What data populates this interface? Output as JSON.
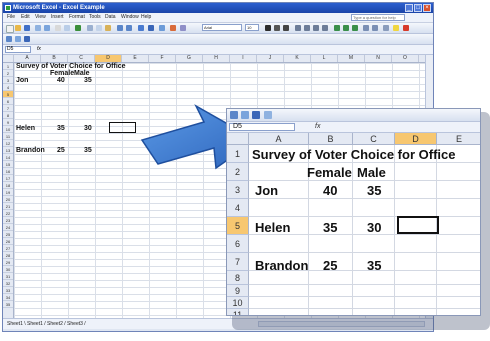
{
  "window": {
    "title": "Microsoft Excel - Excel Example",
    "menus": [
      "File",
      "Edit",
      "View",
      "Insert",
      "Format",
      "Tools",
      "Data",
      "Window",
      "Help"
    ],
    "ask_placeholder": "Type a question for help",
    "font_name": "Arial",
    "font_size": "10"
  },
  "main_sheet": {
    "name_box": "D5",
    "fx_label": "fx",
    "columns": [
      "A",
      "B",
      "C",
      "D",
      "E",
      "F",
      "G",
      "H",
      "I",
      "J",
      "K",
      "L",
      "M",
      "N",
      "O"
    ],
    "selected_column": "D",
    "rows": [
      "1",
      "2",
      "3",
      "4",
      "5",
      "6",
      "7",
      "8",
      "9",
      "10",
      "11",
      "12",
      "13",
      "14",
      "15",
      "16",
      "17",
      "18",
      "19",
      "20",
      "21",
      "22",
      "23",
      "24",
      "25",
      "26",
      "27",
      "28",
      "29",
      "30",
      "31",
      "32",
      "33",
      "34",
      "35"
    ],
    "selected_row": "5",
    "cells": {
      "a1": "Survey of Voter Choice for Office",
      "b2": "Female",
      "c2": "Male",
      "a3": "Jon",
      "b3": "40",
      "c3": "35",
      "a5": "Helen",
      "b5": "35",
      "c5": "30",
      "a7": "Brandon",
      "b7": "25",
      "c7": "35"
    },
    "tabs_text": "Sheet1 \\ Sheet1 / Sheet2 / Sheet3 /"
  },
  "zoom_sheet": {
    "name_box": "D5",
    "fx_label": "fx",
    "columns": [
      "A",
      "B",
      "C",
      "D",
      "E"
    ],
    "selected_column": "D",
    "rows": [
      "1",
      "2",
      "3",
      "4",
      "5",
      "6",
      "7",
      "8",
      "9",
      "10",
      "11"
    ],
    "selected_row": "5",
    "cells": {
      "a1": "Survey of Voter Choice for Office",
      "b2": "Female",
      "c2": "Male",
      "a3": "Jon",
      "b3": "40",
      "c3": "35",
      "a5": "Helen",
      "b5": "35",
      "c5": "30",
      "a7": "Brandon",
      "b7": "25",
      "c7": "35"
    }
  },
  "colors": {
    "title_bar": "#1a44a8",
    "selection_header": "#f7c770",
    "arrow_fill": "#3f7fd0"
  },
  "icons": [
    "excel-app-icon",
    "minimize-icon",
    "maximize-icon",
    "close-icon",
    "callout-arrow-icon"
  ]
}
